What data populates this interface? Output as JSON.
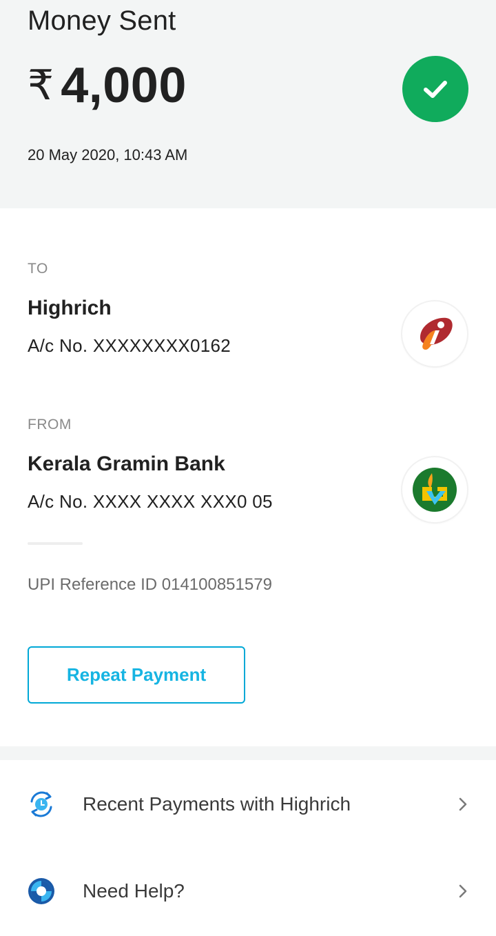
{
  "header": {
    "title": "Money Sent",
    "currency_symbol": "₹",
    "amount": "4,000",
    "timestamp": "20 May 2020, 10:43 AM",
    "status_icon": "check-icon",
    "status_color": "#10ab5c"
  },
  "to": {
    "label": "TO",
    "name": "Highrich",
    "account": "A/c No. XXXXXXXX0162",
    "bank_logo": "icici-logo"
  },
  "from": {
    "label": "FROM",
    "name": "Kerala Gramin Bank",
    "account": "A/c No. XXXX XXXX XXX0 05",
    "bank_logo": "kerala-gramin-bank-logo"
  },
  "reference": "UPI Reference ID 014100851579",
  "repeat_button": "Repeat Payment",
  "actions": [
    {
      "label": "Recent Payments with Highrich",
      "icon": "history-icon"
    },
    {
      "label": "Need Help?",
      "icon": "lifebuoy-icon"
    }
  ],
  "accent_color": "#16b4e2"
}
